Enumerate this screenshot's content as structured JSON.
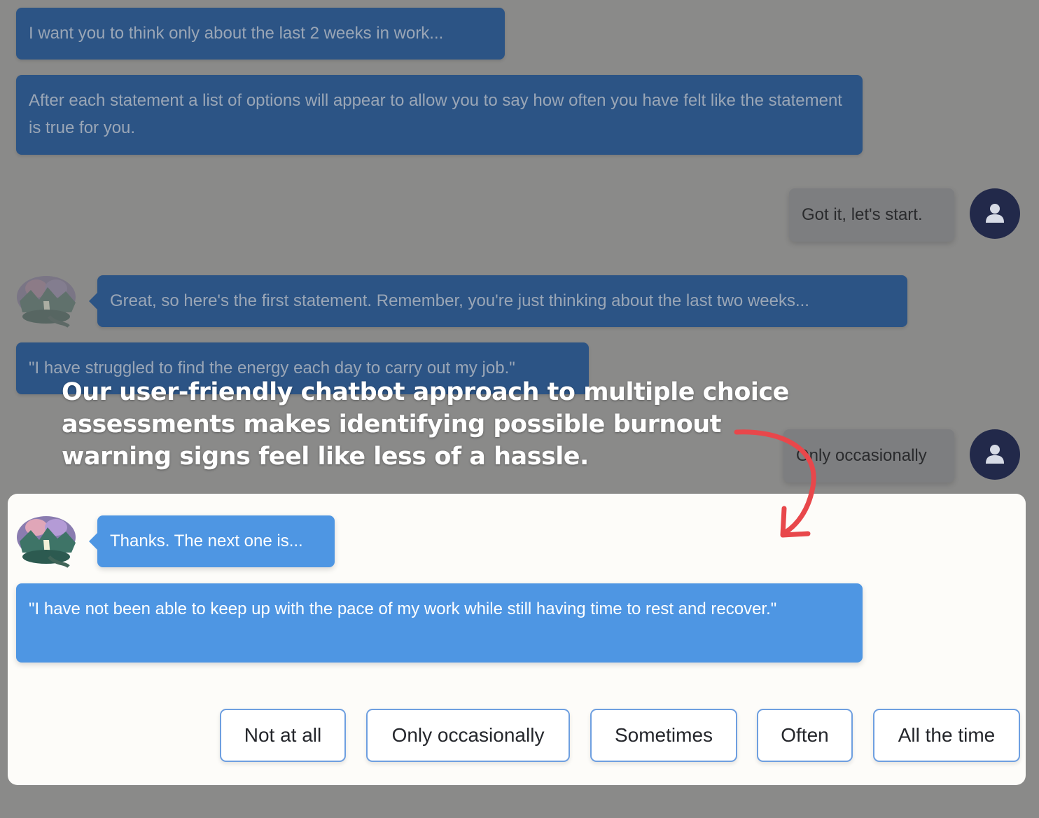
{
  "chat": {
    "messages": {
      "intro_weeks": "I want you to think only about the last 2 weeks in work...",
      "instructions": "After each statement a list of options will appear to allow you to say how often you have felt like the statement is true for you.",
      "user_start": "Got it, let's start.",
      "first_statement_intro": "Great, so here's the first statement. Remember, you're just thinking about the last two weeks...",
      "statement_1": "\"I have struggled to find the energy each day to carry out my job.\"",
      "user_answer_1": "Only occasionally",
      "next_intro": "Thanks. The next one is...",
      "statement_2": "\"I have not been able to keep up with the pace of my work while still having time to rest and recover.\""
    },
    "icons": {
      "user_avatar": "user-icon",
      "bot_avatar": "brain-landscape-avatar"
    }
  },
  "choices": {
    "not_at_all": "Not at all",
    "only_occasionally": "Only occasionally",
    "sometimes": "Sometimes",
    "often": "Often",
    "all_the_time": "All the time"
  },
  "overlay": {
    "caption": "Our user-friendly chatbot approach to multiple choice assessments makes identifying possible burnout warning signs feel like less of a hassle.",
    "arrow_color": "#e8474b"
  },
  "colors": {
    "bot_bubble_dim": "#2c5485",
    "bot_bubble_active": "#4e96e3",
    "user_avatar_bg": "#22294a",
    "choice_border": "#6e9fe0"
  }
}
